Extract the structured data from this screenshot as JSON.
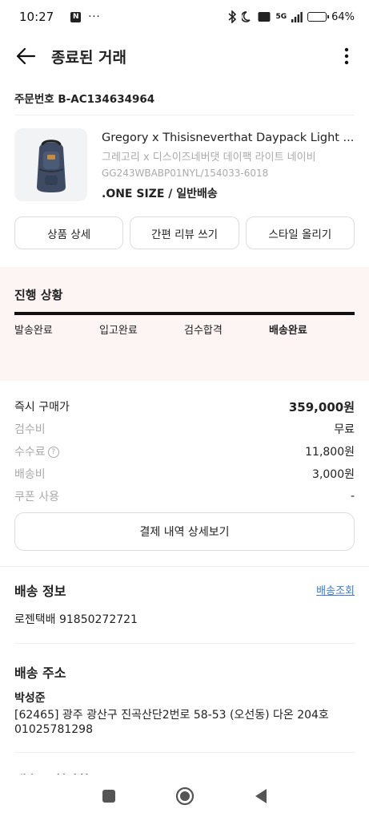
{
  "status_bar": {
    "time": "10:27",
    "notification_badge": "N",
    "more_dots": "···",
    "network": "5G",
    "battery": "64%",
    "battery_level": 0.64
  },
  "header": {
    "title": "종료된 거래"
  },
  "order": {
    "number": "주문번호 B-AC134634964"
  },
  "product": {
    "name": "Gregory x Thisisneverthat Daypack Light ...",
    "name_ko": "그레고리 x 디스이즈네버댓 데이팩 라이트 네이비",
    "code": "GG243WBABP01NYL/154033-6018",
    "option": ".ONE SIZE / 일반배송"
  },
  "actions": {
    "detail": "상품 상세",
    "review": "간편 리뷰 쓰기",
    "style": "스타일 올리기"
  },
  "progress": {
    "label": "진행 상황",
    "steps": [
      "발송완료",
      "입고완료",
      "검수합격",
      "배송완료"
    ]
  },
  "prices": [
    {
      "label": "즉시 구매가",
      "value": "359,000원"
    },
    {
      "label": "검수비",
      "value": "무료"
    },
    {
      "label": "수수료",
      "value": "11,800원"
    },
    {
      "label": "배송비",
      "value": "3,000원"
    },
    {
      "label": "쿠폰 사용",
      "value": "-"
    }
  ],
  "payment_detail_button": "결제 내역 상세보기",
  "shipping": {
    "title": "배송 정보",
    "track_link": "배송조회",
    "carrier_tracking": "로젠택배 91850272721"
  },
  "address": {
    "title": "배송 주소",
    "name": "박성준",
    "line": "[62465] 광주 광산구 진곡산단2번로 58-53 (오선동) 다온 204호",
    "phone": "01025781298"
  },
  "request": {
    "title": "배송 요청사항"
  },
  "colors": {
    "progress_bg": "#fdf4f4",
    "link": "#3a7bd5",
    "muted": "#aaaaaa"
  },
  "icons": {
    "back": "arrow-left-icon",
    "more": "more-vertical-icon",
    "fee_info": "question-circle-icon",
    "nav_recents": "square-icon",
    "nav_home": "circle-icon",
    "nav_back": "triangle-back-icon"
  }
}
